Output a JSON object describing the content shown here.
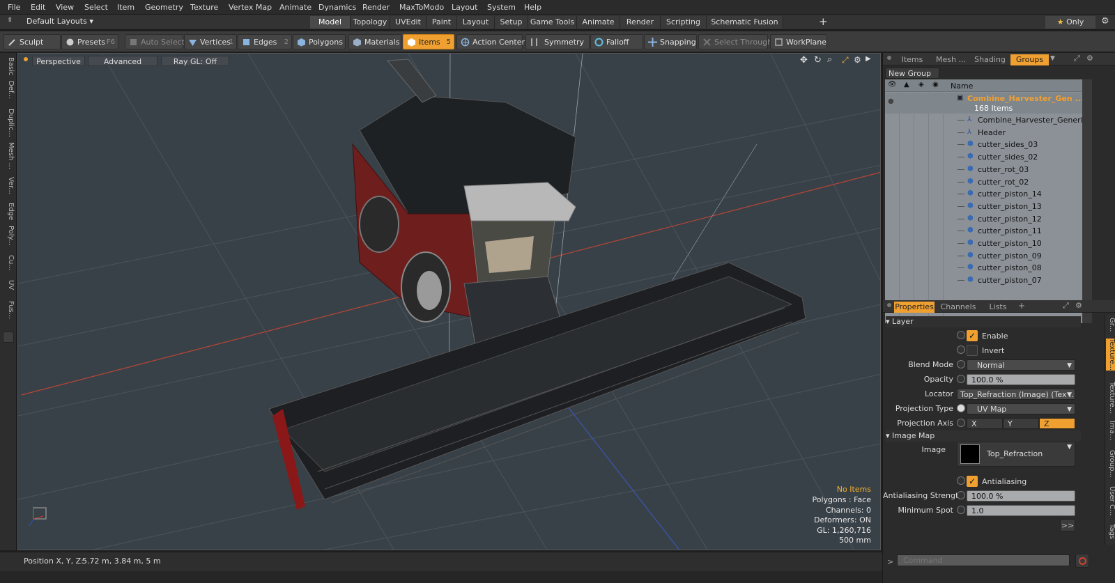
{
  "menu": [
    "File",
    "Edit",
    "View",
    "Select",
    "Item",
    "Geometry",
    "Texture",
    "Vertex Map",
    "Animate",
    "Dynamics",
    "Render",
    "MaxToModo",
    "Layout",
    "System",
    "Help"
  ],
  "layouts": {
    "default_label": "Default Layouts",
    "tabs": [
      "Model",
      "Topology",
      "UVEdit",
      "Paint",
      "Layout",
      "Setup",
      "Game Tools",
      "Animate",
      "Render",
      "Scripting",
      "Schematic Fusion"
    ],
    "active_tab": "Model",
    "add": "+",
    "only_label": "Only",
    "star": "★"
  },
  "toolbar": {
    "sculpt": "Sculpt",
    "presets": "Presets",
    "presets_shortcut": "F6",
    "auto_select": "Auto Select",
    "vertices": "Vertices",
    "vertices_shortcut": "1",
    "edges": "Edges",
    "edges_shortcut": "2",
    "polygons": "Polygons",
    "materials": "Materials",
    "items": "Items",
    "items_shortcut": "5",
    "action_center": "Action Center",
    "symmetry": "Symmetry",
    "falloff": "Falloff",
    "snapping": "Snapping",
    "select_through": "Select Through",
    "workplane": "WorkPlane"
  },
  "left_tabs": [
    "Basic",
    "Def...",
    "Duplic...",
    "Mesh ...",
    "Ver...",
    "Edge",
    "Poly...",
    "Cu...",
    "UV",
    "Fus..."
  ],
  "viewport": {
    "perspective": "Perspective",
    "advanced": "Advanced",
    "raygl": "Ray GL: Off",
    "stats": {
      "no_items": "No Items",
      "polygons": "Polygons : Face",
      "channels": "Channels: 0",
      "deformers": "Deformers: ON",
      "gl": "GL: 1,260,716",
      "size": "500 mm"
    },
    "colors": {
      "bg": "#394148",
      "grid": "#4a535a",
      "xaxis": "#c04030",
      "zaxis": "#3050c0"
    }
  },
  "status": {
    "position_label": "Position X, Y, Z:",
    "position_value": "5.72 m, 3.84 m, 5 m"
  },
  "right_panel": {
    "tabs": [
      "Items",
      "Mesh ...",
      "Shading",
      "Groups"
    ],
    "active_tab": "Groups",
    "new_group": "New Group",
    "name_header": "Name",
    "group_name": "Combine_Harvester_Gen ...",
    "group_count": "168 Items",
    "items": [
      "Combine_Harvester_Generic",
      "Header",
      "cutter_sides_03",
      "cutter_sides_02",
      "cutter_rot_03",
      "cutter_rot_02",
      "cutter_piston_14",
      "cutter_piston_13",
      "cutter_piston_12",
      "cutter_piston_11",
      "cutter_piston_10",
      "cutter_piston_09",
      "cutter_piston_08",
      "cutter_piston_07"
    ],
    "prop_tabs": [
      "Properties",
      "Channels",
      "Lists"
    ],
    "prop_active": "Properties",
    "add": "+"
  },
  "properties": {
    "layer_section": "Layer",
    "enable": "Enable",
    "invert": "Invert",
    "blend_mode_label": "Blend Mode",
    "blend_mode": "Normal",
    "opacity_label": "Opacity",
    "opacity": "100.0 %",
    "locator_label": "Locator",
    "locator": "Top_Refraction (Image) (Tex ...",
    "projection_type_label": "Projection Type",
    "projection_type": "UV Map",
    "projection_axis_label": "Projection Axis",
    "axes": [
      "X",
      "Y",
      "Z"
    ],
    "axis_active": "Z",
    "image_map_section": "Image Map",
    "image_label": "Image",
    "image": "Top_Refraction",
    "antialiasing": "Antialiasing",
    "aa_strength_label": "Antialiasing Strength",
    "aa_strength": "100.0 %",
    "min_spot_label": "Minimum Spot",
    "min_spot": "1.0",
    "more": ">>"
  },
  "right_side_tabs": [
    "Gr...",
    "Texture...",
    "Texture...",
    "Ima...",
    "Group...",
    "User C...",
    "Tags"
  ],
  "command": {
    "placeholder": "Command"
  },
  "accent": "#f0a030"
}
